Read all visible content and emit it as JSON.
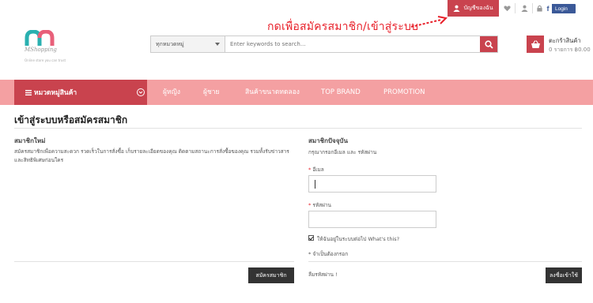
{
  "topbar": {
    "annotation": "กดเพื่อสมัครสมาชิก/เข้าสู่ระบบ",
    "account_label": "บัญชีของฉัน",
    "facebook_label": "Login",
    "facebook_letter": "f"
  },
  "header": {
    "logo_name": "MShopping",
    "logo_tagline": "Online store you can trust",
    "search": {
      "category": "ทุกหมวดหมู่",
      "placeholder": "Enter keywords to search..."
    },
    "cart": {
      "title": "ตะกร้าสินค้า",
      "summary": "0 รายการ ฿0.00"
    }
  },
  "nav": {
    "category_label": "หมวดหมู่สินค้า",
    "items": [
      "ผู้หญิง",
      "ผู้ชาย",
      "สินค้าขนาดทดลอง",
      "TOP BRAND",
      "PROMOTION"
    ]
  },
  "main": {
    "title": "เข้าสู่ระบบหรือสมัครสมาชิก",
    "new_member": {
      "heading": "สมาชิกใหม่",
      "description": "สมัครสมาชิกเพื่อความสะดวก รวดเร็วในการสั่งซื้อ เก็บรายละเอียดของคุณ ติดตามสถานะการสั่งซื้อของคุณ รวมทั้งรับข่าวสารและสิทธิพิเศษก่อนใคร",
      "register_button": "สมัครสมาชิก"
    },
    "existing_member": {
      "heading": "สมาชิกปัจจุบัน",
      "instruction": "กรุณากรอกอีเมล และ รหัสผ่าน",
      "required_mark": "*",
      "email_label": "อีเมล",
      "email_value": "",
      "password_label": "รหัสผ่าน",
      "password_value": "",
      "remember_label": "ให้ฉันอยู่ในระบบต่อไป What's this?",
      "remember_checked": true,
      "required_note": "* จำเป็นต้องกรอก",
      "forgot_link": "ลืมรหัสผ่าน !",
      "login_button": "ลงชื่อเข้าใช้"
    }
  },
  "colors": {
    "accent": "#c9434e",
    "nav_bg": "#f4a0a2",
    "annotation": "#e8202a",
    "dark_button": "#333333",
    "facebook": "#3b5998"
  }
}
